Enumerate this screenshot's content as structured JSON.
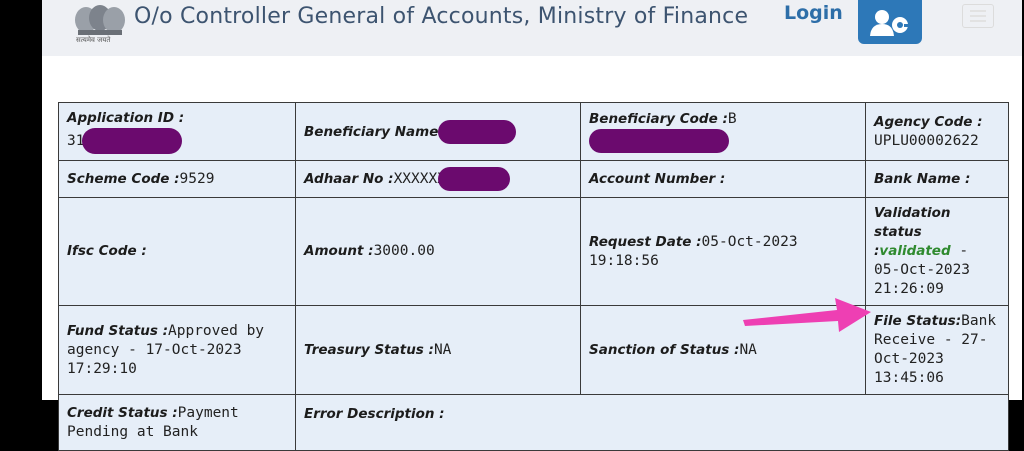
{
  "header": {
    "emblem_text": "सत्यमेव जयते",
    "title": "O/o Controller General of Accounts, Ministry of Finance",
    "login_label": "Login"
  },
  "colors": {
    "header_bg": "#eef0f4",
    "table_bg": "#e6eef8",
    "validated": "#2f8a2f",
    "arrow": "#ee3fb3",
    "redaction": "#6b0a6e"
  },
  "icons": {
    "login": "user-key-icon",
    "menu": "hamburger-menu-icon",
    "emblem": "national-emblem-icon"
  },
  "details": {
    "application_id": {
      "label": "Application ID :",
      "value": "31"
    },
    "beneficiary_name": {
      "label": "Beneficiary Name",
      "value": ""
    },
    "beneficiary_code": {
      "label": "Beneficiary Code :",
      "value": "B"
    },
    "agency_code": {
      "label": "Agency Code :",
      "value": "UPLU00002622"
    },
    "scheme_code": {
      "label": "Scheme Code :",
      "value": "9529"
    },
    "adhaar_no": {
      "label": "Adhaar No :",
      "value": "XXXXXX"
    },
    "account_number": {
      "label": "Account Number :",
      "value": ""
    },
    "bank_name": {
      "label": "Bank Name :",
      "value": ""
    },
    "ifsc_code": {
      "label": "Ifsc Code :",
      "value": ""
    },
    "amount": {
      "label": "Amount :",
      "value": "3000.00"
    },
    "request_date": {
      "label": "Request Date :",
      "value": "05-Oct-2023 19:18:56"
    },
    "validation_status": {
      "label": "Validation status :",
      "status": "validated",
      "value": " - 05-Oct-2023 21:26:09"
    },
    "fund_status": {
      "label": "Fund Status :",
      "value": "Approved by agency - 17-Oct-2023 17:29:10"
    },
    "treasury_status": {
      "label": "Treasury Status :",
      "value": "NA"
    },
    "sanction_status": {
      "label": "Sanction of Status :",
      "value": "NA"
    },
    "file_status": {
      "label": "File Status:",
      "value": "Bank Receive - 27-Oct-2023 13:45:06"
    },
    "credit_status": {
      "label": "Credit Status :",
      "value": "Payment Pending at Bank"
    },
    "error_description": {
      "label": "Error Description :",
      "value": ""
    }
  }
}
